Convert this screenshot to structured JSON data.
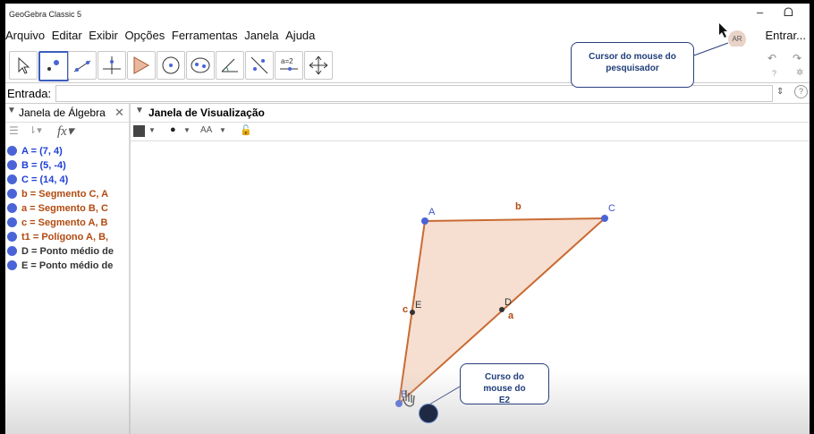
{
  "window": {
    "title": "GeoGebra Classic 5",
    "min": "–",
    "restore": "ᗝ"
  },
  "menu": {
    "items": [
      "Arquivo",
      "Editar",
      "Exibir",
      "Opções",
      "Ferramentas",
      "Janela",
      "Ajuda"
    ],
    "login": "Entrar..."
  },
  "user": {
    "initials": "AR"
  },
  "toolbar": {
    "slider_label": "a=2"
  },
  "input_bar": {
    "label": "Entrada:",
    "value": ""
  },
  "algebra_view": {
    "title": "Janela de Álgebra",
    "items": [
      {
        "text": "A = (7, 4)",
        "color": "#1f3fd8"
      },
      {
        "text": "B = (5, -4)",
        "color": "#1f3fd8"
      },
      {
        "text": "C = (14, 4)",
        "color": "#1f3fd8"
      },
      {
        "text": "b = Segmento C, A",
        "color": "#b24a10"
      },
      {
        "text": "a = Segmento B, C",
        "color": "#b24a10"
      },
      {
        "text": "c = Segmento A, B",
        "color": "#b24a10"
      },
      {
        "text": "t1 = Polígono A, B,",
        "color": "#b24a10"
      },
      {
        "text": "D = Ponto médio de",
        "color": "#333333"
      },
      {
        "text": "E = Ponto médio de",
        "color": "#333333"
      }
    ]
  },
  "graphics_view": {
    "title": "Janela de Visualização",
    "labels": {
      "A": "A",
      "B": "B",
      "C": "C",
      "D": "D",
      "E": "E",
      "a": "a",
      "b": "b",
      "c": "c"
    },
    "colors": {
      "polygon_fill": "#f5d9c8",
      "segment": "#c96b33",
      "point": "#4a64d8",
      "midpoint": "#333333"
    }
  },
  "annotations": {
    "researcher": "Cursor do mouse do pesquisador",
    "student": "Curso do mouse do E2"
  }
}
